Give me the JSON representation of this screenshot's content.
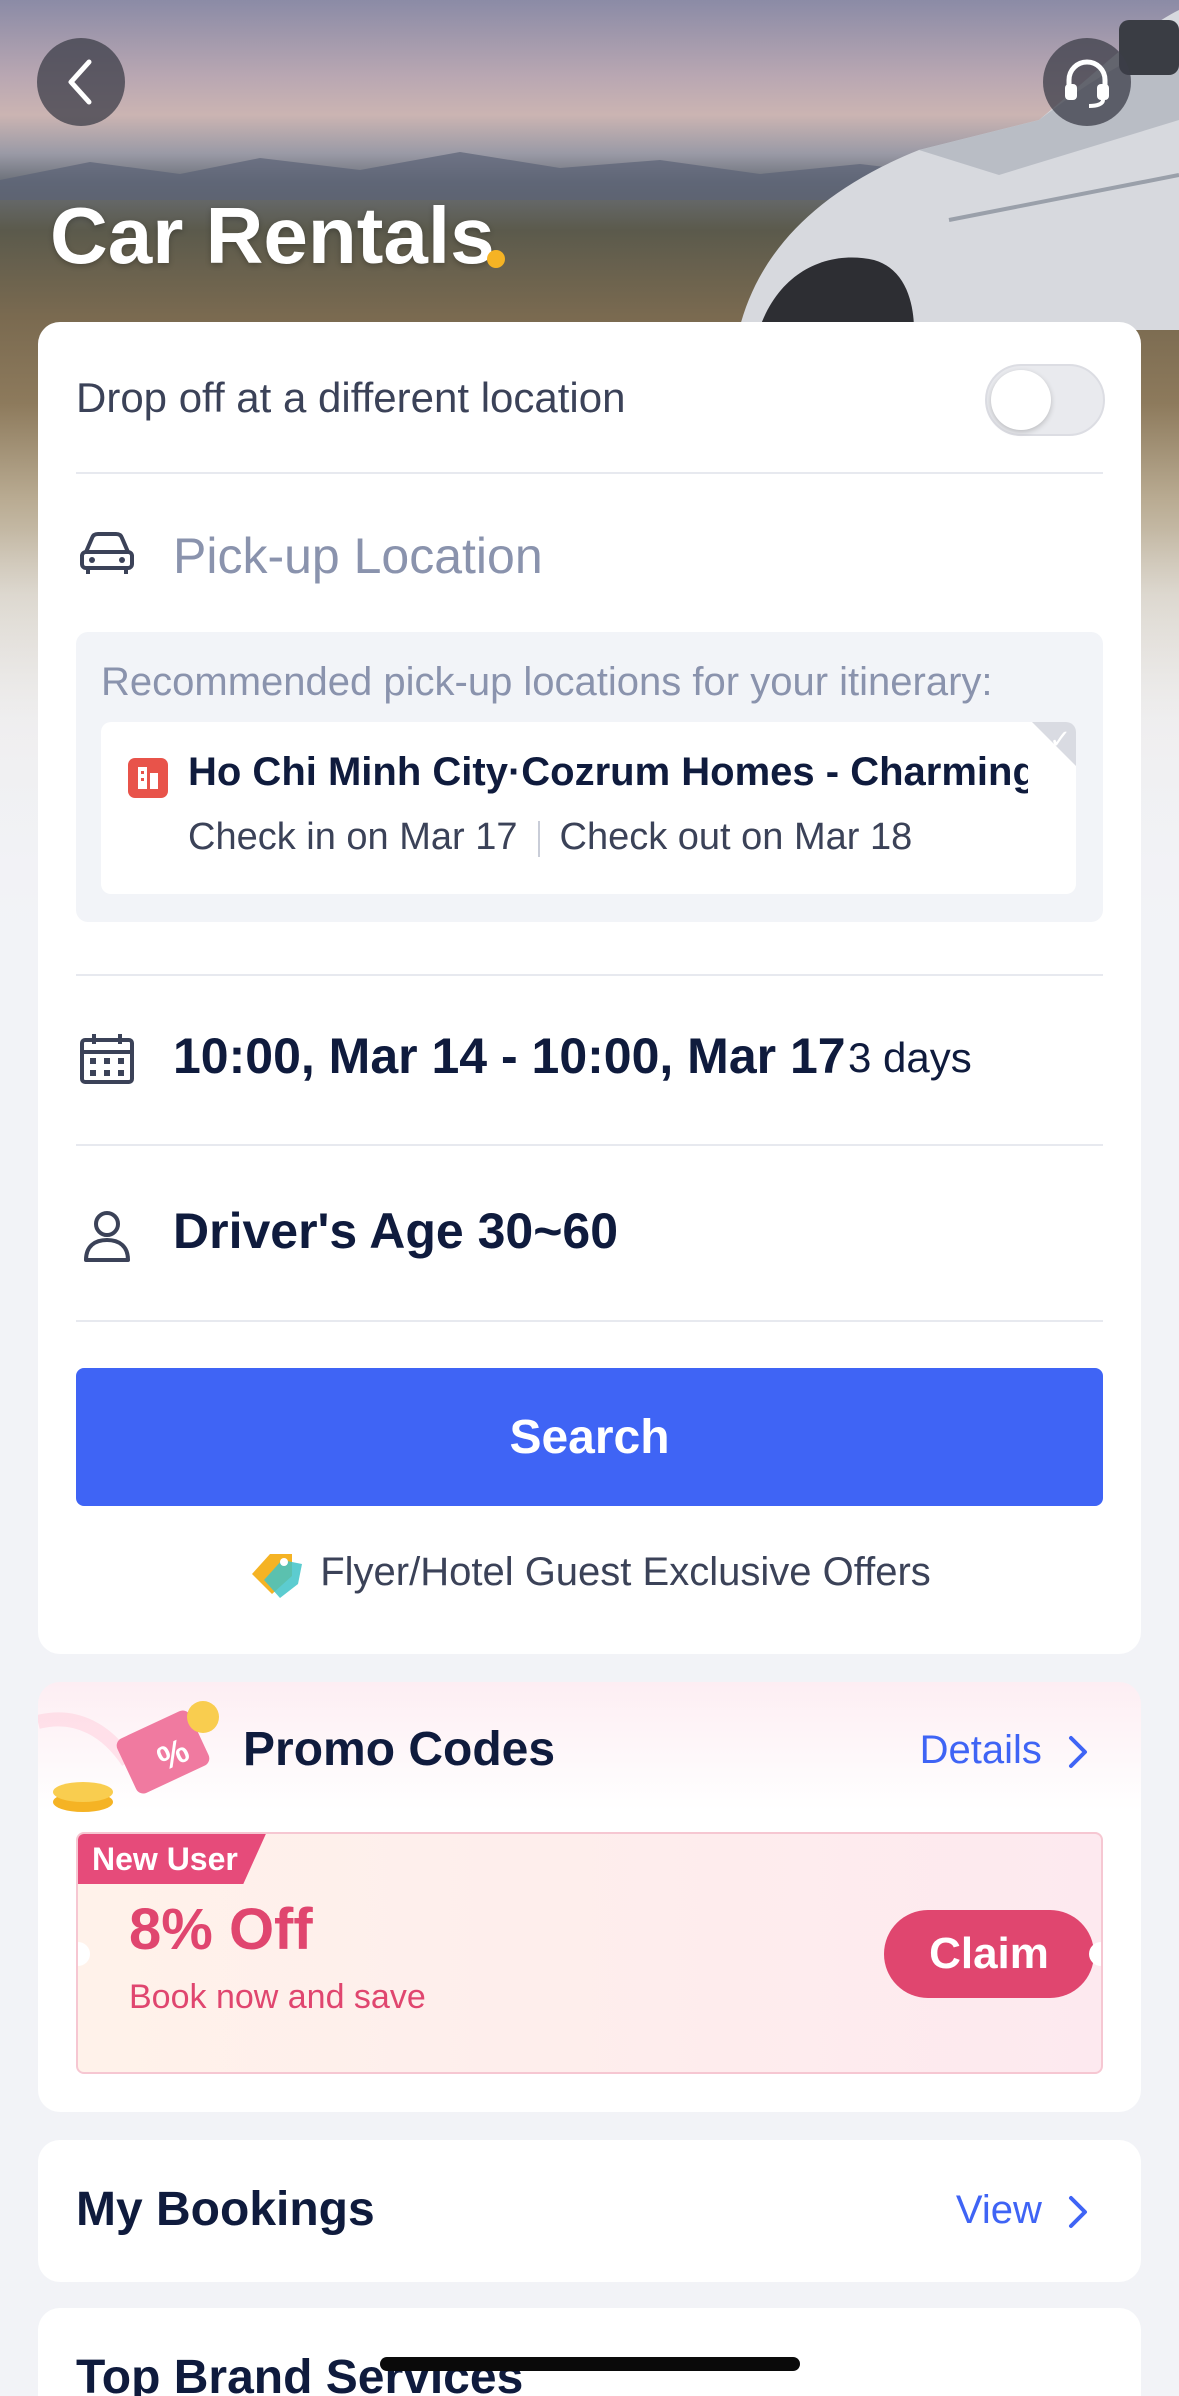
{
  "header": {
    "title": "Car Rentals",
    "back_icon": "chevron-left-icon",
    "support_icon": "headset-icon",
    "accent_dot_color": "#f5b324"
  },
  "search_form": {
    "dropoff_toggle_label": "Drop off at a different location",
    "dropoff_toggle_on": false,
    "pickup_placeholder": "Pick-up Location",
    "recommendation": {
      "title": "Recommended pick-up locations for your itinerary:",
      "hotel_name": "Ho Chi Minh City·Cozrum Homes - Charming...",
      "check_in": "Check in on Mar 17",
      "check_out": "Check out on Mar 18"
    },
    "dates": "10:00, Mar 14 - 10:00, Mar 17",
    "duration": "3 days",
    "driver_age": "Driver's Age 30~60",
    "search_label": "Search",
    "offers_text": "Flyer/Hotel Guest Exclusive Offers"
  },
  "promo": {
    "title": "Promo Codes",
    "details_label": "Details",
    "coupon": {
      "badge": "New User",
      "amount": "8% Off",
      "subtitle": "Book now and save",
      "claim_label": "Claim"
    }
  },
  "bookings": {
    "title": "My Bookings",
    "view_label": "View"
  },
  "brands": {
    "title": "Top Brand Services"
  },
  "colors": {
    "primary": "#3f64f5",
    "promo_pink": "#e0466f",
    "text_dark": "#0f1b3d"
  }
}
